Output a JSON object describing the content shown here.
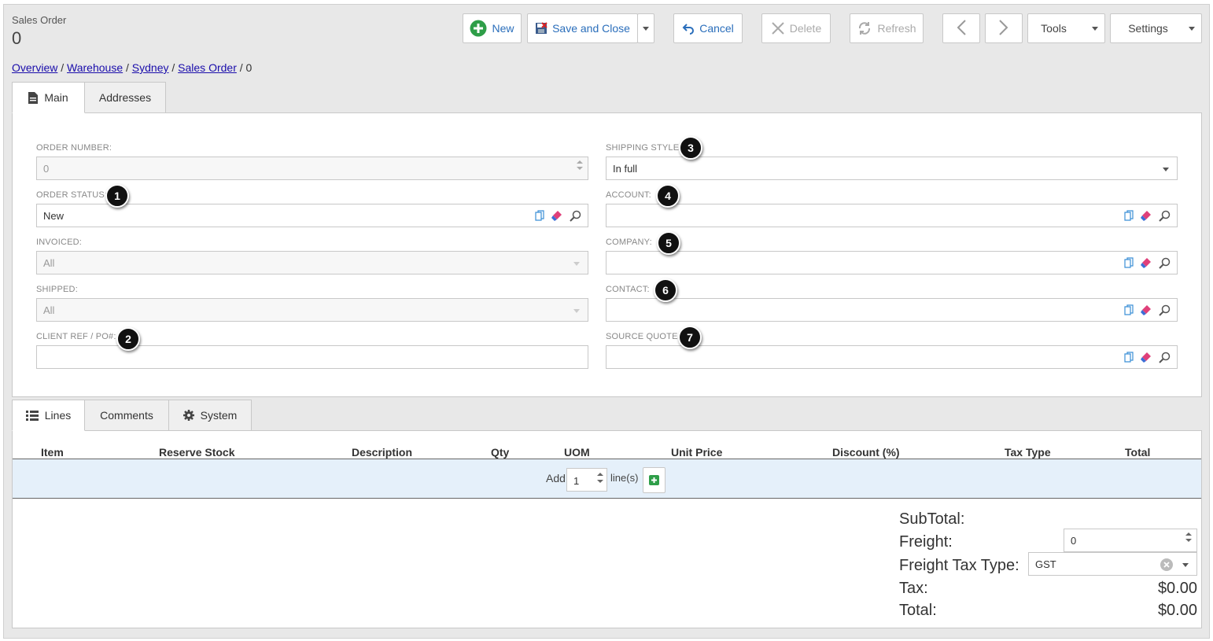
{
  "header": {
    "window_title": "Sales Order",
    "record_number": "0"
  },
  "toolbar": {
    "new_label": "New",
    "save_close_label": "Save and Close",
    "cancel_label": "Cancel",
    "delete_label": "Delete",
    "refresh_label": "Refresh",
    "tools_label": "Tools",
    "settings_label": "Settings"
  },
  "breadcrumb": {
    "items": [
      "Overview",
      "Warehouse",
      "Sydney",
      "Sales Order"
    ],
    "sep": "/",
    "current": "0"
  },
  "tabs": {
    "main": "Main",
    "addresses": "Addresses"
  },
  "form": {
    "order_number_label": "ORDER NUMBER:",
    "order_number_value": "0",
    "order_status_label": "ORDER STATUS:",
    "order_status_value": "New",
    "invoiced_label": "INVOICED:",
    "invoiced_value": "All",
    "shipped_label": "SHIPPED:",
    "shipped_value": "All",
    "client_ref_label": "CLIENT REF / PO#:",
    "client_ref_value": "",
    "shipping_style_label": "SHIPPING STYLE:",
    "shipping_style_value": "In full",
    "account_label": "ACCOUNT:",
    "company_label": "COMPANY:",
    "contact_label": "CONTACT:",
    "source_quote_label": "SOURCE QUOTE:"
  },
  "callouts": [
    "1",
    "2",
    "3",
    "4",
    "5",
    "6",
    "7"
  ],
  "bottom_tabs": {
    "lines": "Lines",
    "comments": "Comments",
    "system": "System"
  },
  "lines_table": {
    "columns": [
      "Item",
      "Reserve Stock",
      "Description",
      "Qty",
      "UOM",
      "Unit Price",
      "Discount (%)",
      "Tax Type",
      "Total"
    ],
    "add_label": "Add",
    "add_qty": "1",
    "lines_suffix": "line(s)"
  },
  "totals": {
    "subtotal_label": "SubTotal:",
    "freight_label": "Freight:",
    "freight_value": "0",
    "freight_tax_label": "Freight Tax Type:",
    "freight_tax_value": "GST",
    "tax_label": "Tax:",
    "tax_value": "$0.00",
    "total_label": "Total:",
    "total_value": "$0.00"
  },
  "colors": {
    "link": "#1a0dab",
    "button_text": "#2a6ebb",
    "add_icon": "#2e9e48",
    "eraser": "#e0407a",
    "add_row_bg": "#e5f0fa"
  }
}
